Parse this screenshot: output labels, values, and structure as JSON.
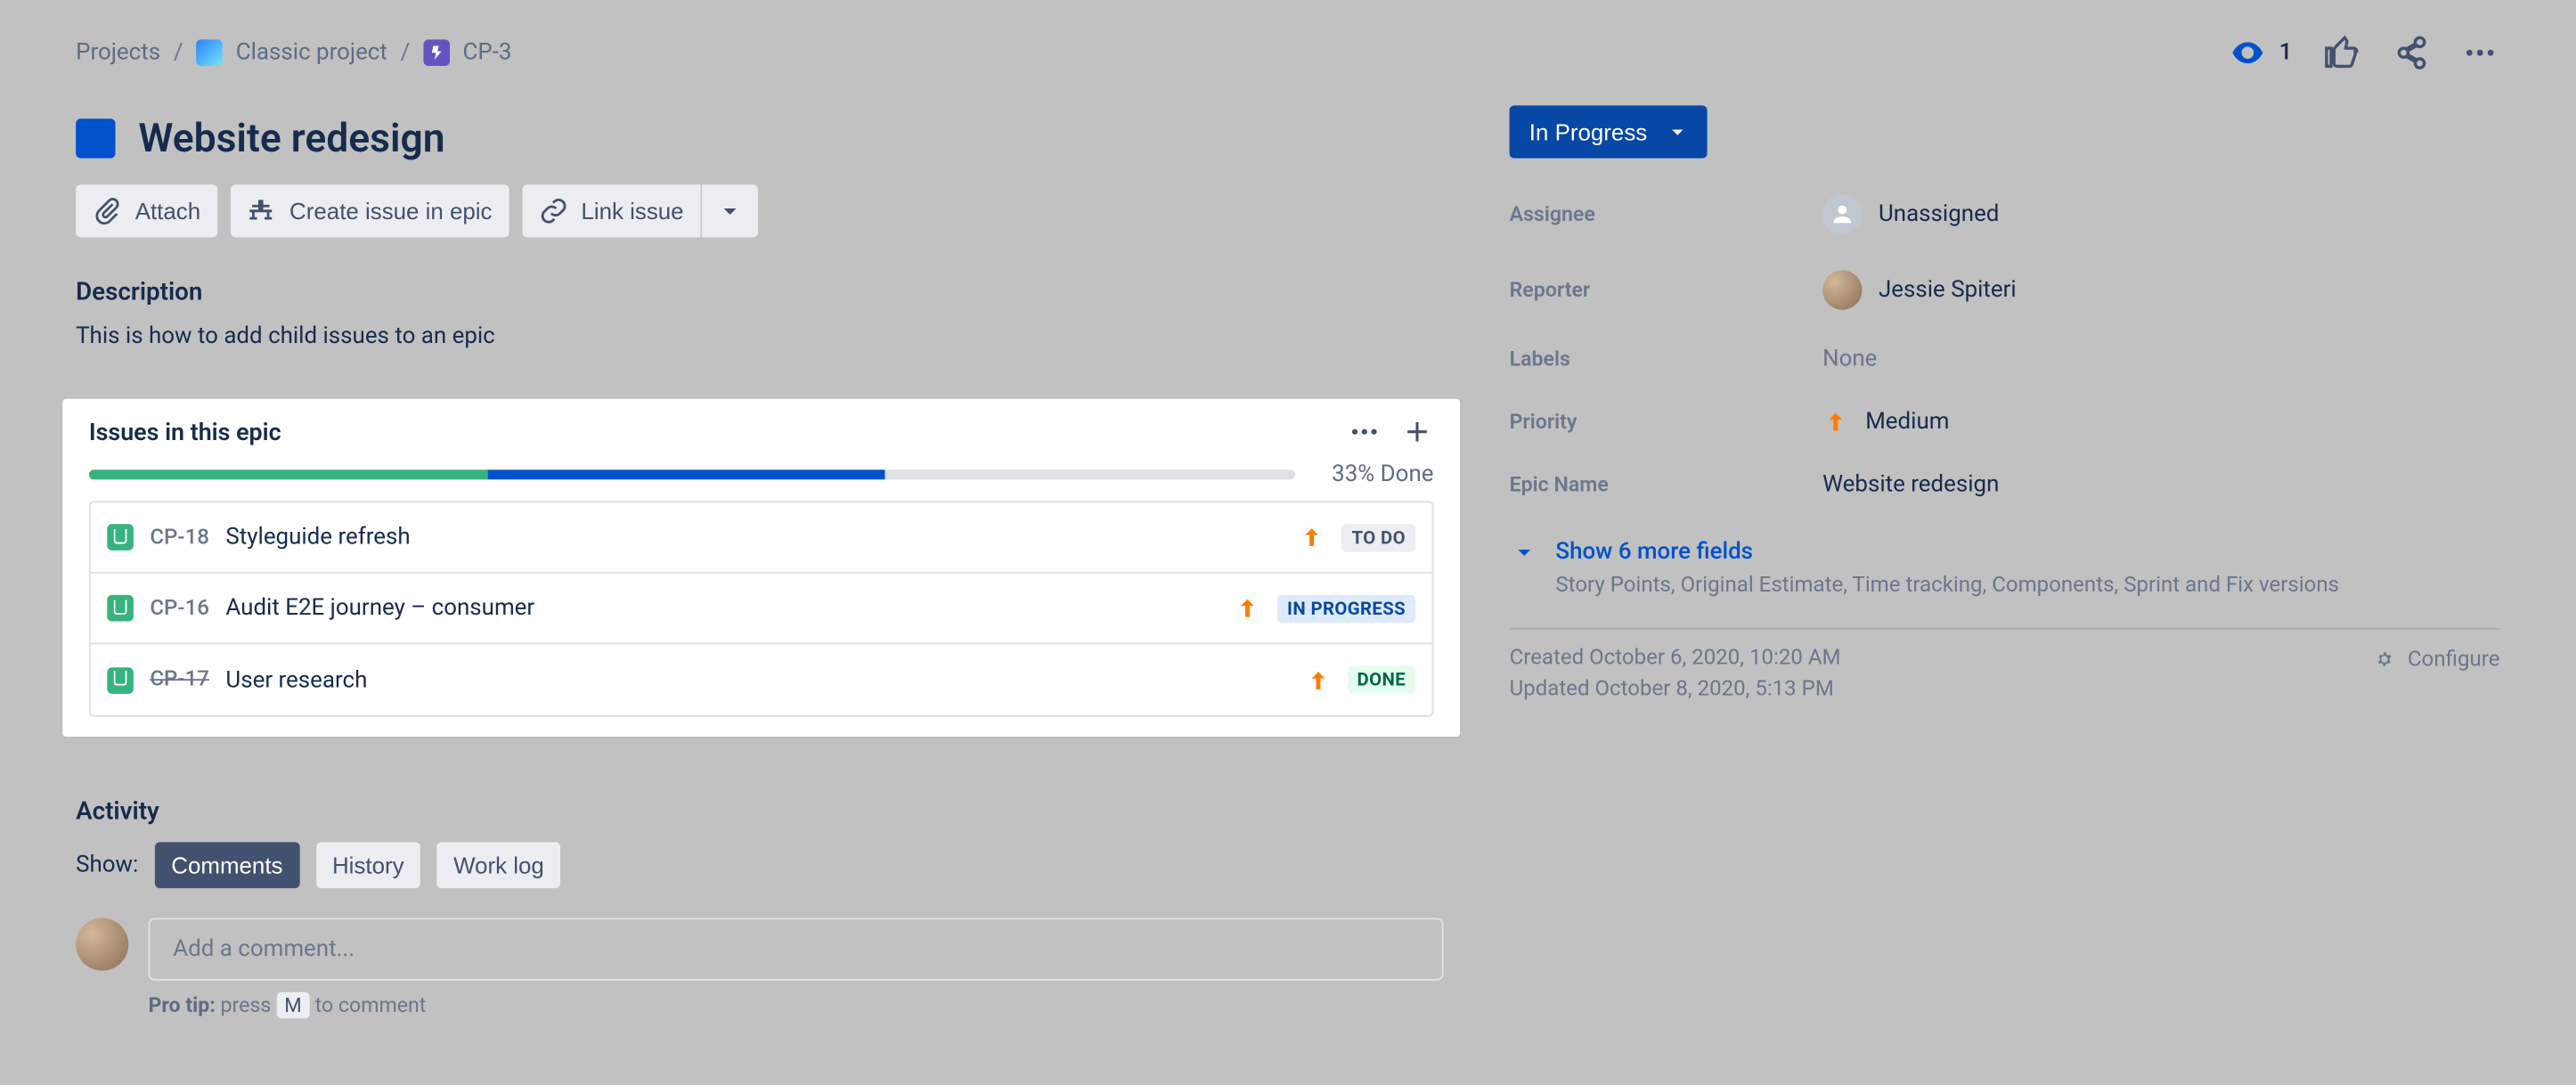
{
  "breadcrumbs": {
    "root": "Projects",
    "project": "Classic project",
    "key": "CP-3"
  },
  "watchers": "1",
  "title": "Website redesign",
  "actions": {
    "attach": "Attach",
    "create_in_epic": "Create issue in epic",
    "link": "Link issue"
  },
  "description": {
    "heading": "Description",
    "body": "This is how to add child issues to an epic"
  },
  "epic_panel": {
    "heading": "Issues in this epic",
    "progress_text": "33% Done",
    "progress": {
      "done_pct": 33,
      "inprogress_pct": 33
    },
    "children": [
      {
        "key": "CP-18",
        "title": "Styleguide refresh",
        "status": "TO DO",
        "status_class": "todo",
        "done": false
      },
      {
        "key": "CP-16",
        "title": "Audit E2E journey – consumer",
        "status": "IN PROGRESS",
        "status_class": "inprogress",
        "done": false
      },
      {
        "key": "CP-17",
        "title": "User research",
        "status": "DONE",
        "status_class": "done",
        "done": true
      }
    ]
  },
  "activity": {
    "heading": "Activity",
    "show_label": "Show:",
    "tabs": {
      "comments": "Comments",
      "history": "History",
      "worklog": "Work log"
    },
    "placeholder": "Add a comment...",
    "protip_prefix": "Pro tip:",
    "protip_press": " press ",
    "protip_key": "M",
    "protip_suffix": " to comment"
  },
  "status": "In Progress",
  "fields": {
    "assignee": {
      "label": "Assignee",
      "value": "Unassigned"
    },
    "reporter": {
      "label": "Reporter",
      "value": "Jessie Spiteri"
    },
    "labels": {
      "label": "Labels",
      "value": "None"
    },
    "priority": {
      "label": "Priority",
      "value": "Medium"
    },
    "epicname": {
      "label": "Epic Name",
      "value": "Website redesign"
    }
  },
  "show_more": {
    "label": "Show 6 more fields",
    "sub": "Story Points, Original Estimate, Time tracking, Components, Sprint and Fix versions"
  },
  "meta": {
    "created": "Created October 6, 2020, 10:20 AM",
    "updated": "Updated October 8, 2020, 5:13 PM",
    "configure": "Configure"
  }
}
